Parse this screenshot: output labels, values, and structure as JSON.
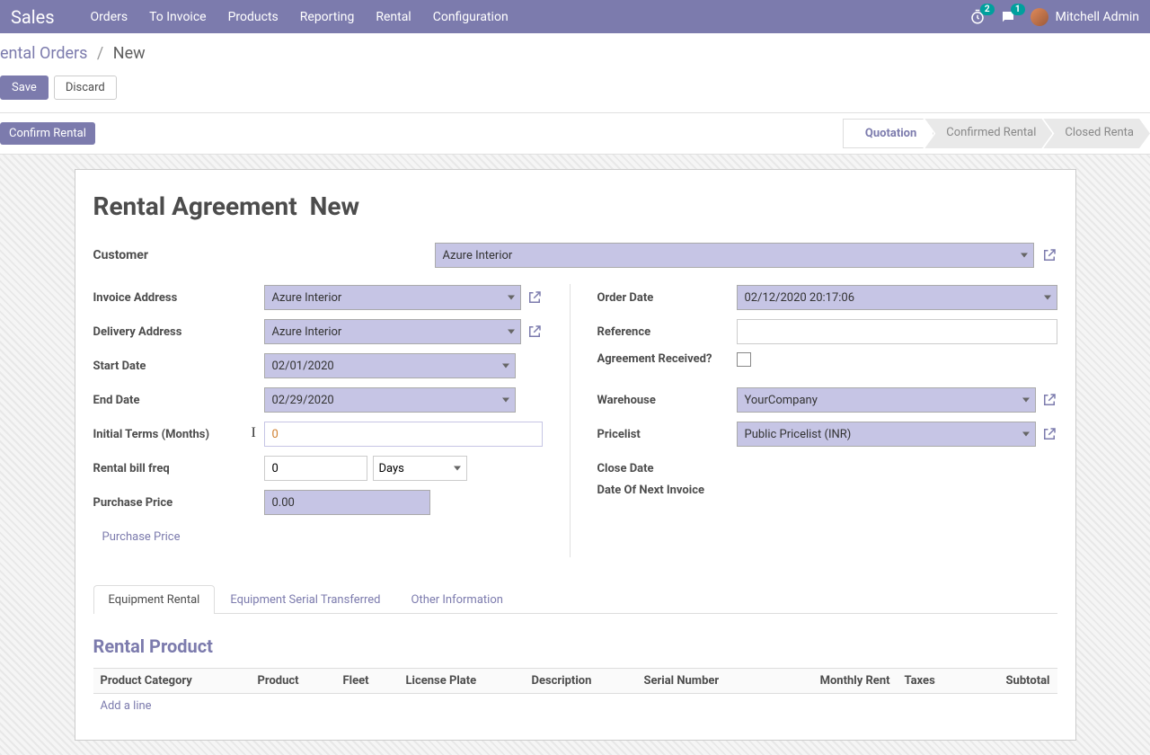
{
  "topbar": {
    "brand": "Sales",
    "menu": [
      "Orders",
      "To Invoice",
      "Products",
      "Reporting",
      "Rental",
      "Configuration"
    ],
    "timer_badge": "2",
    "chat_badge": "1",
    "user": "Mitchell Admin"
  },
  "breadcrumb": {
    "parent": "ental Orders",
    "current": "New"
  },
  "actions": {
    "save": "Save",
    "discard": "Discard",
    "confirm": "Confirm Rental"
  },
  "stages": {
    "s1": "Quotation",
    "s2": "Confirmed Rental",
    "s3": "Closed Renta"
  },
  "form": {
    "title_prefix": "Rental Agreement",
    "title_value": "New",
    "customer_label": "Customer",
    "customer_value": "Azure Interior",
    "invoice_addr_label": "Invoice Address",
    "invoice_addr_value": "Azure Interior",
    "delivery_addr_label": "Delivery Address",
    "delivery_addr_value": "Azure Interior",
    "start_date_label": "Start Date",
    "start_date_value": "02/01/2020",
    "end_date_label": "End Date",
    "end_date_value": "02/29/2020",
    "initial_terms_label": "Initial Terms (Months)",
    "initial_terms_value": "0",
    "rental_freq_label": "Rental bill freq",
    "rental_freq_num": "0",
    "rental_freq_unit": "Days",
    "purchase_price_label": "Purchase Price",
    "purchase_price_value": "0.00",
    "purchase_price_link": "Purchase Price",
    "order_date_label": "Order Date",
    "order_date_value": "02/12/2020 20:17:06",
    "reference_label": "Reference",
    "reference_value": "",
    "agreement_label": "Agreement Received?",
    "warehouse_label": "Warehouse",
    "warehouse_value": "YourCompany",
    "pricelist_label": "Pricelist",
    "pricelist_value": "Public Pricelist (INR)",
    "close_date_label": "Close Date",
    "next_invoice_label": "Date Of Next Invoice"
  },
  "tabs": {
    "t1": "Equipment Rental",
    "t2": "Equipment Serial Transferred",
    "t3": "Other Information"
  },
  "section": {
    "title": "Rental Product",
    "cols": {
      "c1": "Product Category",
      "c2": "Product",
      "c3": "Fleet",
      "c4": "License Plate",
      "c5": "Description",
      "c6": "Serial Number",
      "c7": "Monthly Rent",
      "c8": "Taxes",
      "c9": "Subtotal"
    },
    "add_line": "Add a line"
  }
}
